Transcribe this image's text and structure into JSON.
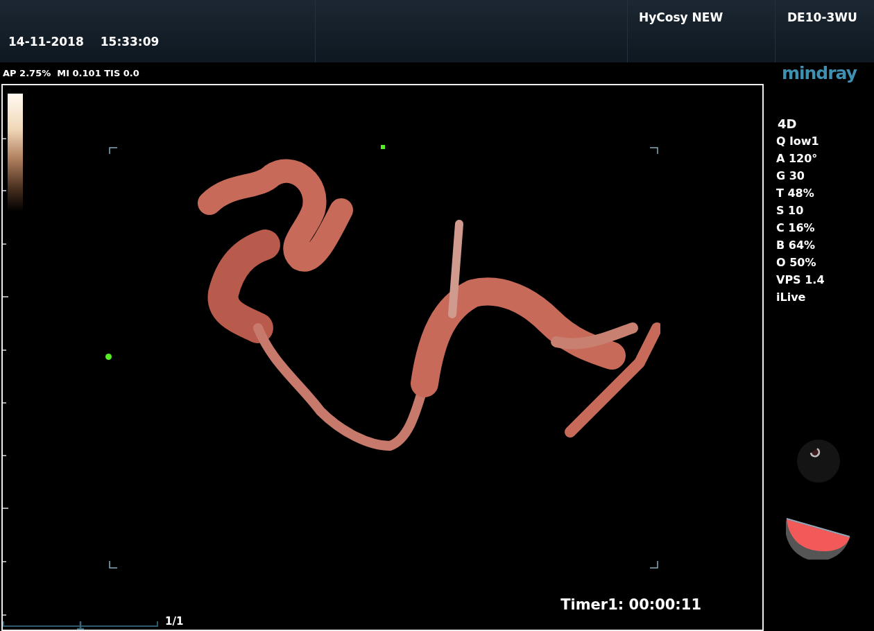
{
  "header": {
    "date": "14-11-2018",
    "time": "15:33:09",
    "exam": "HyCosy NEW",
    "probe": "DE10-3WU"
  },
  "acoustic_output": "AP 2.75%  MI 0.101 TIS 0.0",
  "logo": "mindray",
  "parameters": [
    "4D",
    "Q low1",
    "A 120°",
    "G 30",
    "T 48%",
    "S 10",
    "C 16%",
    "B 64%",
    "O 50%",
    "VPS 1.4",
    "iLive"
  ],
  "image": {
    "timer": "Timer1: 00:00:11",
    "cine": {
      "frame": "1/1",
      "level": 0.5
    }
  }
}
